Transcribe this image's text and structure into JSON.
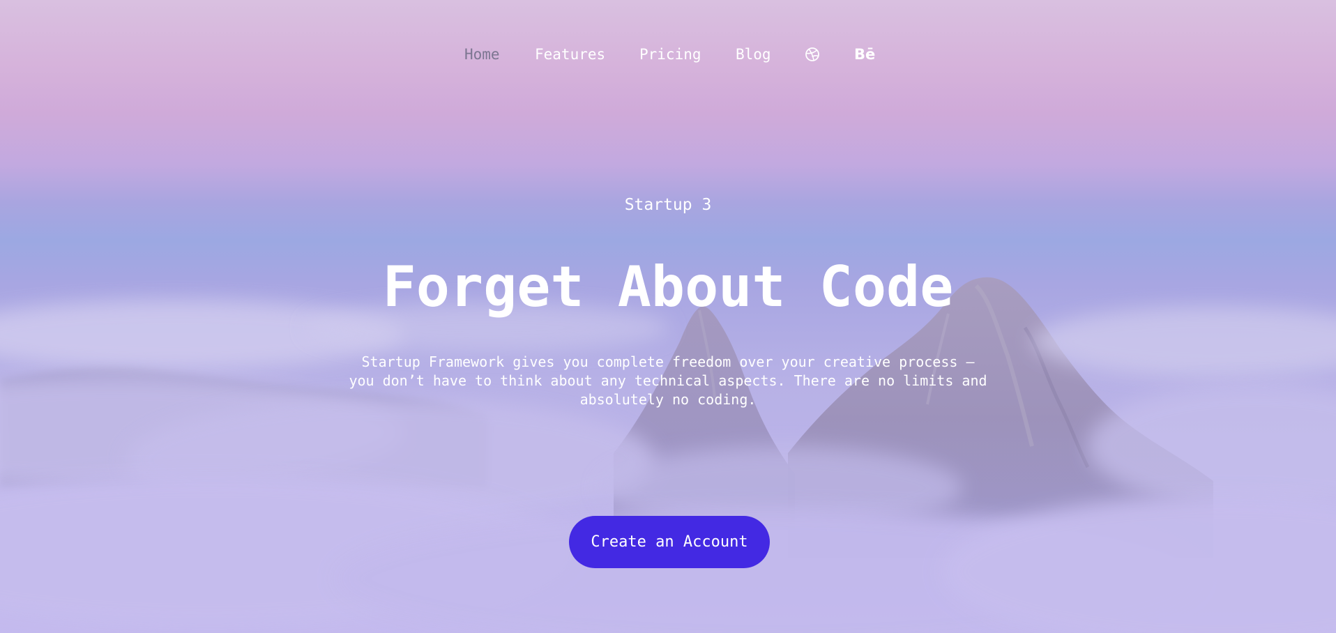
{
  "nav": {
    "items": [
      {
        "label": "Home",
        "active": true
      },
      {
        "label": "Features",
        "active": false
      },
      {
        "label": "Pricing",
        "active": false
      },
      {
        "label": "Blog",
        "active": false
      }
    ],
    "icons": [
      "dribbble-icon",
      "behance-icon"
    ],
    "behance_glyph": "Bē"
  },
  "hero": {
    "eyebrow": "Startup 3",
    "title": "Forget About Code",
    "description": "Startup Framework gives you complete freedom over your creative process — you don’t have to think about any technical aspects. There are no limits and absolutely no coding.",
    "cta_label": "Create an Account"
  },
  "colors": {
    "accent": "#4329e3",
    "active_nav": "#7c7691",
    "text": "#ffffff"
  }
}
